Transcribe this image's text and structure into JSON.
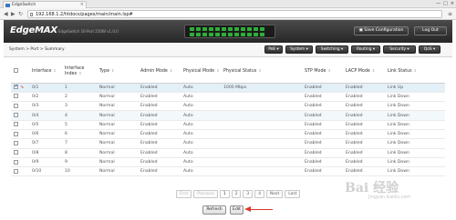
{
  "browser": {
    "tab_title": "EdgeSwitch",
    "url": "192.168.1.2/htdocs/pages/main/main.lsp#",
    "close_glyph": "×",
    "window_controls": [
      "—",
      "□",
      "×"
    ]
  },
  "header": {
    "logo": "EdgeMAX",
    "subtitle": "EdgeSwitch 16-Port 250W v1.0.0",
    "save_label": "Save Configuration",
    "logout_label": "Log Out",
    "port_led_color": "#2fae3a"
  },
  "nav": {
    "breadcrumb": "System > Port > Summary",
    "menu": [
      "PoE",
      "System",
      "Switching",
      "Routing",
      "Security",
      "QoS"
    ]
  },
  "table": {
    "headers": [
      "Interface",
      "Interface Index",
      "Type",
      "Admin Mode",
      "Physical Mode",
      "Physical Status",
      "STP Mode",
      "LACP Mode",
      "Link Status"
    ],
    "rows": [
      [
        "0/1",
        "1",
        "Normal",
        "Enabled",
        "Auto",
        "1000 Mbps",
        "Enabled",
        "Enabled",
        "Link Up"
      ],
      [
        "0/2",
        "2",
        "Normal",
        "Enabled",
        "Auto",
        "",
        "Enabled",
        "Enabled",
        "Link Down"
      ],
      [
        "0/3",
        "3",
        "Normal",
        "Enabled",
        "Auto",
        "",
        "Enabled",
        "Enabled",
        "Link Down"
      ],
      [
        "0/4",
        "4",
        "Normal",
        "Enabled",
        "Auto",
        "",
        "Enabled",
        "Enabled",
        "Link Down"
      ],
      [
        "0/5",
        "5",
        "Normal",
        "Enabled",
        "Auto",
        "",
        "Enabled",
        "Enabled",
        "Link Down"
      ],
      [
        "0/6",
        "6",
        "Normal",
        "Enabled",
        "Auto",
        "",
        "Enabled",
        "Enabled",
        "Link Down"
      ],
      [
        "0/7",
        "7",
        "Normal",
        "Enabled",
        "Auto",
        "",
        "Enabled",
        "Enabled",
        "Link Down"
      ],
      [
        "0/8",
        "8",
        "Normal",
        "Enabled",
        "Auto",
        "",
        "Enabled",
        "Enabled",
        "Link Down"
      ],
      [
        "0/9",
        "9",
        "Normal",
        "Enabled",
        "Auto",
        "",
        "Enabled",
        "Enabled",
        "Link Down"
      ],
      [
        "0/10",
        "10",
        "Normal",
        "Enabled",
        "Auto",
        "",
        "Enabled",
        "Enabled",
        "Link Down"
      ]
    ]
  },
  "pager": {
    "first": "First",
    "previous": "Previous",
    "pages": [
      "1",
      "2",
      "3",
      "4"
    ],
    "next": "Next",
    "last": "Last",
    "current_page": "1"
  },
  "actions": {
    "refresh": "Refresh",
    "edit": "Edit"
  },
  "watermark": {
    "text": "Bai 经验",
    "sub": "jingyan.baidu.com"
  }
}
